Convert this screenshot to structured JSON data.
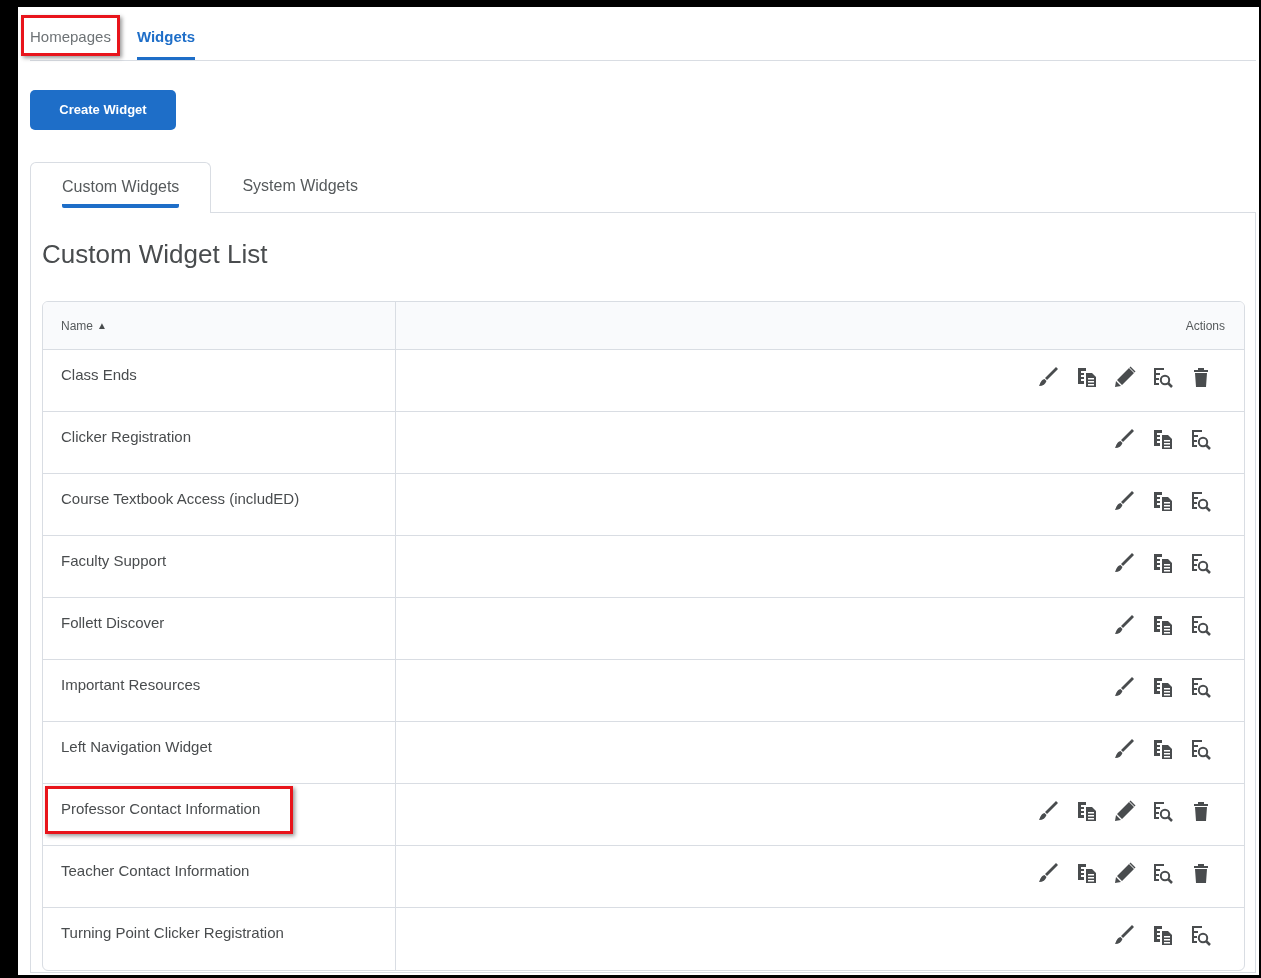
{
  "nav_tabs": [
    {
      "label": "Homepages",
      "selected": false,
      "highlighted": true
    },
    {
      "label": "Widgets",
      "selected": true,
      "highlighted": false
    }
  ],
  "create_button": "Create Widget",
  "list_tabs": [
    {
      "label": "Custom Widgets",
      "selected": true
    },
    {
      "label": "System Widgets",
      "selected": false
    }
  ],
  "heading": "Custom Widget List",
  "table": {
    "columns": [
      {
        "label": "Name",
        "sort_indicator": "▲"
      },
      {
        "label": "Actions"
      }
    ],
    "rows": [
      {
        "name": "Class Ends",
        "highlighted": false,
        "actions": [
          {
            "kind": "brush"
          },
          {
            "kind": "copy"
          },
          {
            "kind": "edit"
          },
          {
            "kind": "preview"
          },
          {
            "kind": "delete"
          }
        ]
      },
      {
        "name": "Clicker Registration",
        "highlighted": false,
        "actions": [
          {
            "kind": "brush"
          },
          {
            "kind": "copy"
          },
          {
            "kind": "preview"
          }
        ]
      },
      {
        "name": "Course Textbook Access (includED)",
        "highlighted": false,
        "actions": [
          {
            "kind": "brush"
          },
          {
            "kind": "copy"
          },
          {
            "kind": "preview"
          }
        ]
      },
      {
        "name": "Faculty Support",
        "highlighted": false,
        "actions": [
          {
            "kind": "brush"
          },
          {
            "kind": "copy"
          },
          {
            "kind": "preview"
          }
        ]
      },
      {
        "name": "Follett Discover",
        "highlighted": false,
        "actions": [
          {
            "kind": "brush"
          },
          {
            "kind": "copy"
          },
          {
            "kind": "preview"
          }
        ]
      },
      {
        "name": "Important Resources",
        "highlighted": false,
        "actions": [
          {
            "kind": "brush"
          },
          {
            "kind": "copy"
          },
          {
            "kind": "preview"
          }
        ]
      },
      {
        "name": "Left Navigation Widget",
        "highlighted": false,
        "actions": [
          {
            "kind": "brush"
          },
          {
            "kind": "copy"
          },
          {
            "kind": "preview"
          }
        ]
      },
      {
        "name": "Professor Contact Information",
        "highlighted": true,
        "actions": [
          {
            "kind": "brush"
          },
          {
            "kind": "copy"
          },
          {
            "kind": "edit"
          },
          {
            "kind": "preview"
          },
          {
            "kind": "delete"
          }
        ]
      },
      {
        "name": "Teacher Contact Information",
        "highlighted": false,
        "actions": [
          {
            "kind": "brush"
          },
          {
            "kind": "copy"
          },
          {
            "kind": "edit"
          },
          {
            "kind": "preview"
          },
          {
            "kind": "delete"
          }
        ]
      },
      {
        "name": "Turning Point Clicker Registration",
        "highlighted": false,
        "actions": [
          {
            "kind": "brush"
          },
          {
            "kind": "copy"
          },
          {
            "kind": "preview"
          }
        ]
      }
    ]
  }
}
